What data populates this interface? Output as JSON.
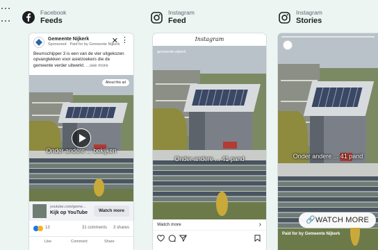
{
  "columns": [
    {
      "platform": "Facebook",
      "placement": "Feeds",
      "menu_glyph": "…",
      "icon": "facebook-logo-icon"
    },
    {
      "platform": "Instagram",
      "placement": "Feed",
      "menu_glyph": "…",
      "icon": "instagram-logo-icon"
    },
    {
      "platform": "Instagram",
      "placement": "Stories",
      "menu_glyph": "",
      "icon": "instagram-logo-icon"
    }
  ],
  "facebook_ad": {
    "page_name": "Gemeente Nijkerk",
    "sponsored_line": "Sponsored · Paid for by Gemeente Nijkerk",
    "close_glyph": "✕",
    "menu_glyph": "⋮",
    "caption": "Beumschipper 3 is een van de vier uitgekozen opvanglekken voor asielzoekers die de gemeente verder uitwerkt.",
    "see_more": "...see more",
    "about_label": "About this ad",
    "overlay_text": "Onder andere ... bekijken",
    "link_domain": "youtube.com/geme...",
    "link_title": "Kijk op YouTube",
    "cta_label": "Watch more",
    "reaction_count": "13",
    "comments": "31 comments",
    "shares": "3 shares",
    "actions": [
      "Like",
      "Comment",
      "Share"
    ]
  },
  "instagram_feed": {
    "header": "Instagram",
    "username": "gemeente.nijkerk",
    "overlay_text": "Onder andere ... 41 pand",
    "cta_label": "Watch more",
    "cta_chevron": "›",
    "icons": [
      "heart-icon",
      "comment-icon",
      "send-icon",
      "bookmark-icon"
    ]
  },
  "instagram_stories": {
    "overlay_text": "Onder andere ... 41 pand",
    "cta_label": "🔗WATCH MORE",
    "footer": "Paid for by Gemeente Nijkerk"
  },
  "colors": {
    "background": "#edf5f3",
    "facebook_blue": "#1877f2",
    "text_primary": "#1c1e21",
    "text_secondary": "#65676b"
  }
}
